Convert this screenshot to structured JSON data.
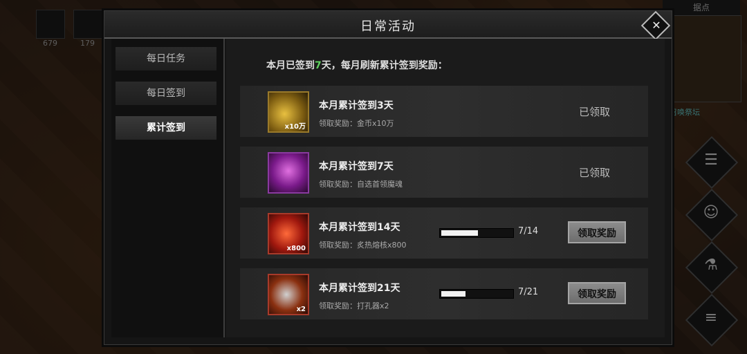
{
  "hud": {
    "counts": [
      "679",
      "179"
    ],
    "minimap_label": "据点",
    "summon_label": "召唤祭坛"
  },
  "dialog": {
    "title": "日常活动"
  },
  "tabs": [
    {
      "label": "每日任务",
      "active": false
    },
    {
      "label": "每日签到",
      "active": false
    },
    {
      "label": "累计签到",
      "active": true
    }
  ],
  "summary": {
    "prefix": "本月已签到",
    "days": "7",
    "suffix": "天，每月刷新累计签到奖励："
  },
  "rewards": [
    {
      "title": "本月累计签到3天",
      "reward": "领取奖励：金币x10万",
      "qty": "x10万",
      "icon": "gold-coins-icon",
      "status": "已领取"
    },
    {
      "title": "本月累计签到7天",
      "reward": "领取奖励：自选首领魔魂",
      "qty": "",
      "icon": "boss-soul-icon",
      "status": "已领取"
    },
    {
      "title": "本月累计签到14天",
      "reward": "领取奖励：炙热熔核x800",
      "qty": "x800",
      "icon": "fire-core-icon",
      "progress": "7/14",
      "progress_value": 0.5,
      "button": "领取奖励"
    },
    {
      "title": "本月累计签到21天",
      "reward": "领取奖励：打孔器x2",
      "qty": "x2",
      "icon": "drill-icon",
      "progress": "7/21",
      "progress_value": 0.333,
      "button": "领取奖励"
    }
  ],
  "colors": {
    "highlight": "#5fd35f",
    "gold_border": "#9a7a2a",
    "purple_border": "#8a3aa0",
    "red_border": "#a83a2a"
  }
}
